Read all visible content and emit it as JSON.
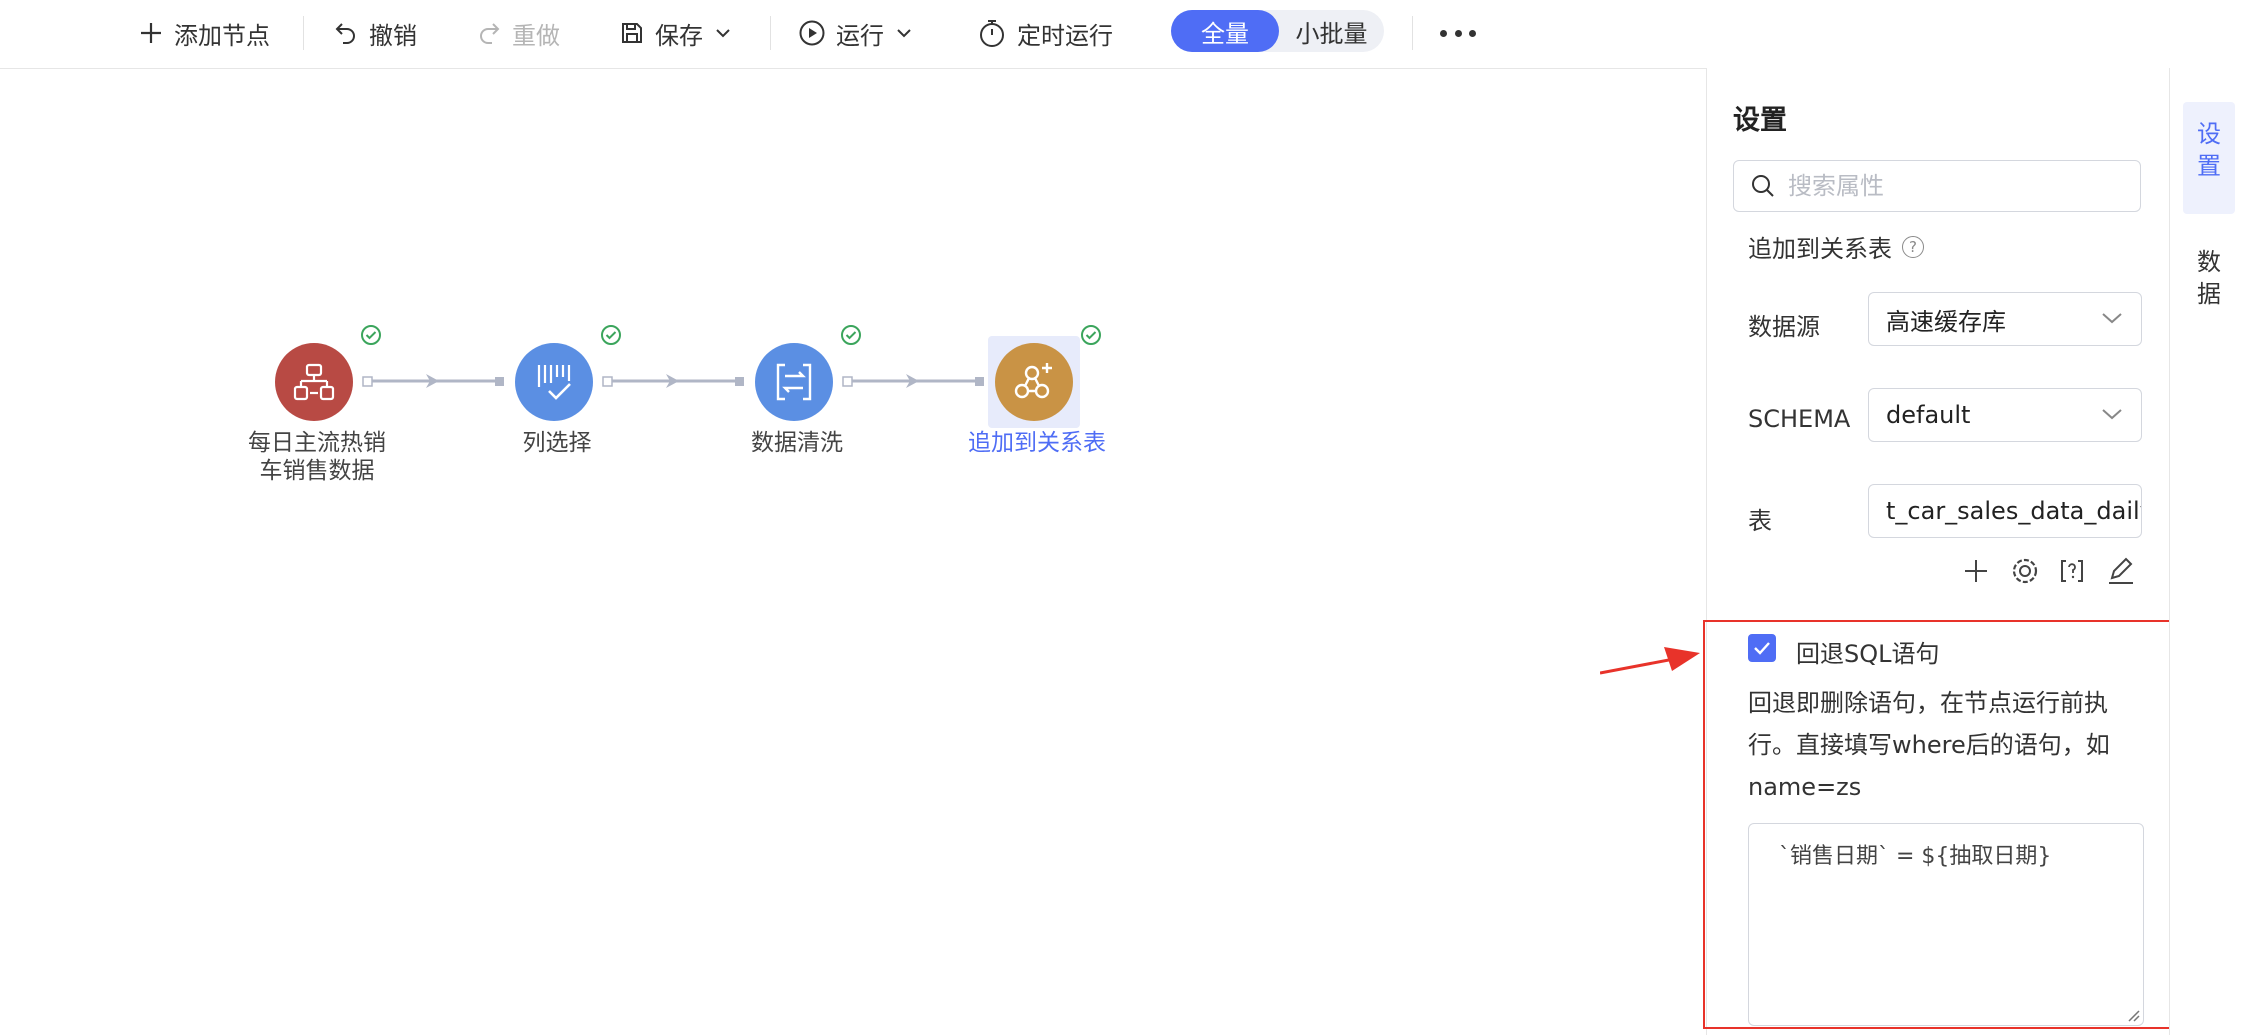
{
  "toolbar": {
    "add_node": "添加节点",
    "undo": "撤销",
    "redo": "重做",
    "save": "保存",
    "run": "运行",
    "scheduled_run": "定时运行",
    "mode_full": "全量",
    "mode_batch": "小批量"
  },
  "flow": {
    "nodes": [
      {
        "label_line1": "每日主流热销",
        "label_line2": "车销售数据",
        "color": "#b84a44",
        "status": "ok",
        "icon": "database-icon"
      },
      {
        "label_line1": "列选择",
        "label_line2": "",
        "color": "#5b8fe3",
        "status": "ok",
        "icon": "column-select-icon"
      },
      {
        "label_line1": "数据清洗",
        "label_line2": "",
        "color": "#5b8fe3",
        "status": "ok",
        "icon": "data-clean-icon"
      },
      {
        "label_line1": "追加到关系表",
        "label_line2": "",
        "color": "#c99345",
        "status": "ok",
        "icon": "append-table-icon",
        "selected": true
      }
    ]
  },
  "panel": {
    "title": "设置",
    "search_placeholder": "搜索属性",
    "section_title": "追加到关系表",
    "help_glyph": "?",
    "fields": {
      "datasource_label": "数据源",
      "datasource_value": "高速缓存库",
      "schema_label": "SCHEMA",
      "schema_value": "default",
      "table_label": "表",
      "table_value": "t_car_sales_data_daily"
    },
    "rollback": {
      "checked": true,
      "label": "回退SQL语句",
      "desc_line1": "回退即删除语句，在节点运行前执",
      "desc_line2": "行。直接填写where后的语句，如",
      "desc_line3": "name=zs",
      "sql": "`销售日期` = ${抽取日期}"
    }
  },
  "sidebar": {
    "tab_settings": "设置",
    "tab_data": "数据"
  },
  "colors": {
    "accent": "#4f6df5",
    "highlight": "#e8332a",
    "ok": "#3ba55c"
  }
}
